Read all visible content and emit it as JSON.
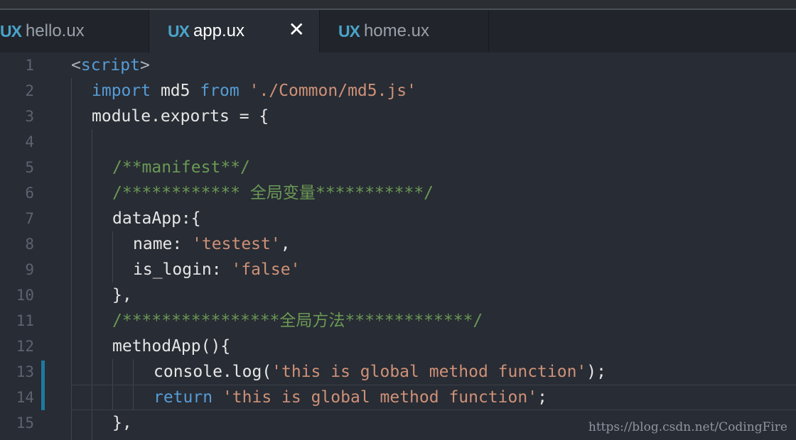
{
  "tabs": [
    {
      "badge": "UX",
      "label": "hello.ux"
    },
    {
      "badge": "UX",
      "label": "app.ux",
      "active": true,
      "close": "✕"
    },
    {
      "badge": "UX",
      "label": "home.ux"
    }
  ],
  "lines": [
    {
      "n": "1",
      "tokens": [
        {
          "t": "<",
          "c": "punc"
        },
        {
          "t": "script",
          "c": "tag"
        },
        {
          "t": ">",
          "c": "punc"
        }
      ]
    },
    {
      "n": "2",
      "tokens": [
        {
          "t": "import",
          "c": "kw"
        },
        {
          "t": " md5 ",
          "c": "id"
        },
        {
          "t": "from",
          "c": "kw"
        },
        {
          "t": " ",
          "c": "id"
        },
        {
          "t": "'./Common/md5.js'",
          "c": "str"
        }
      ]
    },
    {
      "n": "3",
      "tokens": [
        {
          "t": "module.exports = {",
          "c": "id"
        }
      ]
    },
    {
      "n": "4",
      "tokens": []
    },
    {
      "n": "5",
      "tokens": [
        {
          "t": "/**manifest**/",
          "c": "com"
        }
      ]
    },
    {
      "n": "6",
      "tokens": [
        {
          "t": "/************ 全局变量***********/",
          "c": "com"
        }
      ]
    },
    {
      "n": "7",
      "tokens": [
        {
          "t": "dataApp:{",
          "c": "id"
        }
      ]
    },
    {
      "n": "8",
      "tokens": [
        {
          "t": "name: ",
          "c": "id"
        },
        {
          "t": "'testest'",
          "c": "str"
        },
        {
          "t": ",",
          "c": "id"
        }
      ]
    },
    {
      "n": "9",
      "tokens": [
        {
          "t": "is_login: ",
          "c": "id"
        },
        {
          "t": "'false'",
          "c": "str"
        }
      ]
    },
    {
      "n": "10",
      "tokens": [
        {
          "t": "},",
          "c": "id"
        }
      ]
    },
    {
      "n": "11",
      "tokens": [
        {
          "t": "/****************全局方法*************/",
          "c": "com"
        }
      ]
    },
    {
      "n": "12",
      "tokens": [
        {
          "t": "methodApp(){",
          "c": "id"
        }
      ]
    },
    {
      "n": "13",
      "tokens": [
        {
          "t": "console.log(",
          "c": "id"
        },
        {
          "t": "'this is global method function'",
          "c": "str"
        },
        {
          "t": ");",
          "c": "id"
        }
      ]
    },
    {
      "n": "14",
      "tokens": [
        {
          "t": "return",
          "c": "kw"
        },
        {
          "t": " ",
          "c": "id"
        },
        {
          "t": "'this is global method function'",
          "c": "str"
        },
        {
          "t": ";",
          "c": "id"
        }
      ]
    },
    {
      "n": "15",
      "tokens": [
        {
          "t": "},",
          "c": "id"
        }
      ]
    }
  ],
  "watermark": "https://blog.csdn.net/CodingFire"
}
